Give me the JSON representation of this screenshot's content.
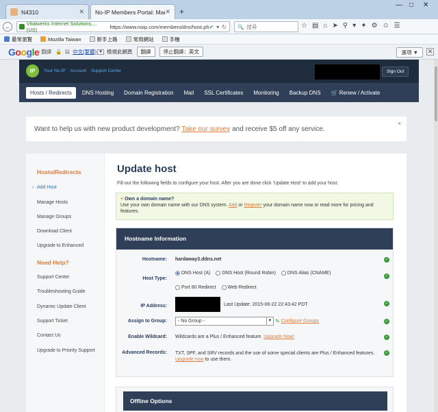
{
  "browser": {
    "tabs": [
      {
        "title": "N4310"
      },
      {
        "title": "No-IP Members Portal: Mana..."
      }
    ],
    "window_controls": [
      "—",
      "□",
      "✕"
    ],
    "address": {
      "secure_label": "Vitalwerks Internet Solutions,... (US)",
      "url": "https://www.noip.com/members/dns/host.ph",
      "search_placeholder": "搜尋"
    },
    "bookmarks": [
      "最常瀏覽",
      "Mozilla Taiwan",
      "新手上路",
      "常用網站",
      "手機"
    ]
  },
  "translate_bar": {
    "brand": "翻譯",
    "to_label": "以",
    "language": "中文(繁體)",
    "view_label": "檢視此網頁",
    "translate_button": "翻譯",
    "stop_button": "停止翻譯：英文",
    "options_button": "選項 ▼"
  },
  "portal": {
    "logo_text": "IP",
    "top_links": [
      "Your No-IP",
      "Account",
      "Support Center"
    ],
    "signout": "Sign Out",
    "nav": [
      "Hosts / Redirects",
      "DNS Hosting",
      "Domain Registration",
      "Mail",
      "SSL Certificates",
      "Monitoring",
      "Backup DNS",
      "Renew / Activate"
    ],
    "survey": {
      "prefix": "Want to help us with new product development?",
      "link": "Take our survey",
      "suffix": "and receive $5 off any service.",
      "close": "×"
    },
    "sidebar": {
      "heading1": "Hosts/Redirects",
      "items1": [
        "Add Host",
        "Manage Hosts",
        "Manage Groups",
        "Download Client",
        "Upgrade to Enhanced"
      ],
      "heading2": "Need Help?",
      "items2": [
        "Support Center",
        "Troubleshooting Guide",
        "Dynamic Update Client",
        "Support Ticket",
        "Contact Us",
        "Upgrade to Priority Support"
      ]
    },
    "main": {
      "title": "Update host",
      "intro": "Fill out the following fields to configure your host. After you are done click 'Update Host' to add your host.",
      "notice": {
        "title": "Own a domain name?",
        "text1": "Use your own domain name with our DNS system.",
        "add": "Add",
        "or": "or",
        "register": "Register",
        "text2": "your domain name now or read more for pricing and features."
      },
      "hostbox_title": "Hostname Information",
      "fields": {
        "hostname_label": "Hostname:",
        "hostname_value": "hardaway3.ddns.net",
        "hosttype_label": "Host Type:",
        "hosttype_options": [
          "DNS Host (A)",
          "DNS Host (Round Robin)",
          "DNS Alias (CNAME)",
          "Port 80 Redirect",
          "Web Redirect"
        ],
        "ip_label": "IP Address:",
        "ip_update": "Last Update: 2015-06-22 22:43:42 PDT",
        "group_label": "Assign to Group:",
        "group_value": "- No Group -",
        "group_link": "Configure Groups",
        "wildcard_label": "Enable Wildcard:",
        "wildcard_text": "Wildcards are a Plus / Enhanced feature.",
        "wildcard_link": "Upgrade Now!",
        "adv_label": "Advanced Records:",
        "adv_text": "TXT, SPF, and SRV records and the use of some special clients are Plus / Enhanced features.",
        "adv_link": "Upgrade now",
        "adv_suffix": "to use them."
      },
      "offline_title": "Offline Options"
    }
  }
}
